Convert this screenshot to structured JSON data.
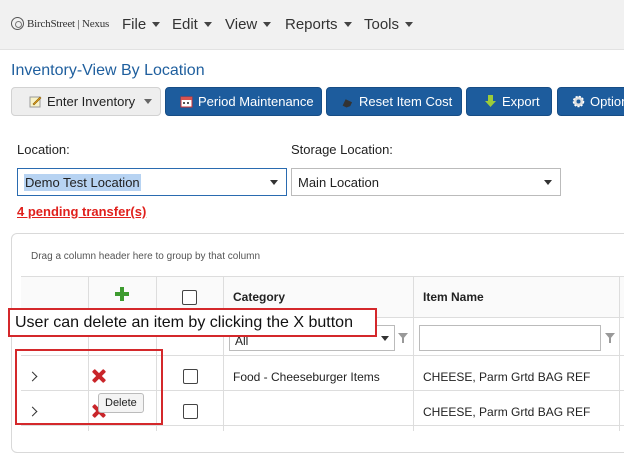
{
  "navbar": {
    "brand": "BirchStreet | Nexus",
    "menus": [
      {
        "label": "File"
      },
      {
        "label": "Edit"
      },
      {
        "label": "View"
      },
      {
        "label": "Reports"
      },
      {
        "label": "Tools"
      }
    ]
  },
  "page": {
    "title": "Inventory-View By Location"
  },
  "toolbar": {
    "enter_inventory": "Enter Inventory",
    "period_maintenance": "Period Maintenance",
    "reset_item_cost": "Reset Item Cost",
    "export": "Export",
    "options": "Options"
  },
  "location": {
    "label": "Location:",
    "value": "Demo Test Location",
    "storage_label": "Storage Location:",
    "storage_value": "Main Location",
    "pending_transfers": "4 pending transfer(s)"
  },
  "grid": {
    "group_hint": "Drag a column header here to group by that column",
    "columns": [
      "Category",
      "Item Name"
    ],
    "filter_category": "All",
    "rows": [
      {
        "category": "Food - Cheeseburger Items",
        "item_name": "CHEESE, Parm Grtd BAG REF"
      },
      {
        "category": "",
        "item_name": "CHEESE, Parm Grtd BAG REF"
      }
    ],
    "delete_tooltip": "Delete"
  },
  "annotation": {
    "text": "User can delete an item by clicking the X button"
  },
  "colors": {
    "brand_blue": "#1d5c9d",
    "title_blue": "#1f5f9e",
    "alert_red": "#e0201c",
    "delete_red": "#c9252a",
    "add_green": "#3d9b2f"
  }
}
